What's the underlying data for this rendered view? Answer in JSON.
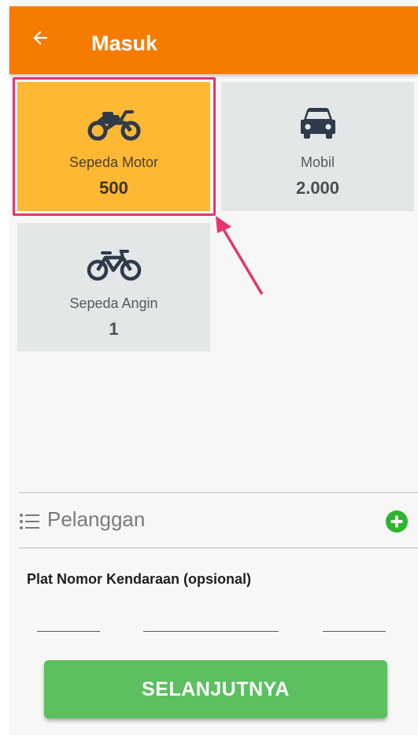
{
  "appbar": {
    "title": "Masuk",
    "back_icon": "arrow-left-icon"
  },
  "vehicle_types": [
    {
      "label": "Sepeda Motor",
      "count": "500",
      "icon": "motorcycle-icon",
      "selected": true
    },
    {
      "label": "Mobil",
      "count": "2.000",
      "icon": "car-icon",
      "selected": false
    },
    {
      "label": "Sepeda Angin",
      "count": "1",
      "icon": "bicycle-icon",
      "selected": false
    }
  ],
  "customer": {
    "label": "Pelanggan",
    "list_icon": "list-icon",
    "add_icon": "plus-circle-icon"
  },
  "plate": {
    "label": "Plat Nomor Kendaraan (opsional)",
    "part1": "",
    "part2": "",
    "part3": ""
  },
  "next_button": {
    "label": "SELANJUTNYA"
  },
  "colors": {
    "appbar": "#f57c00",
    "tile_selected": "#ffb833",
    "tile_default": "#e3e7e8",
    "highlight": "#e8336f",
    "button": "#5cbf60",
    "add_icon": "#2db52d"
  }
}
